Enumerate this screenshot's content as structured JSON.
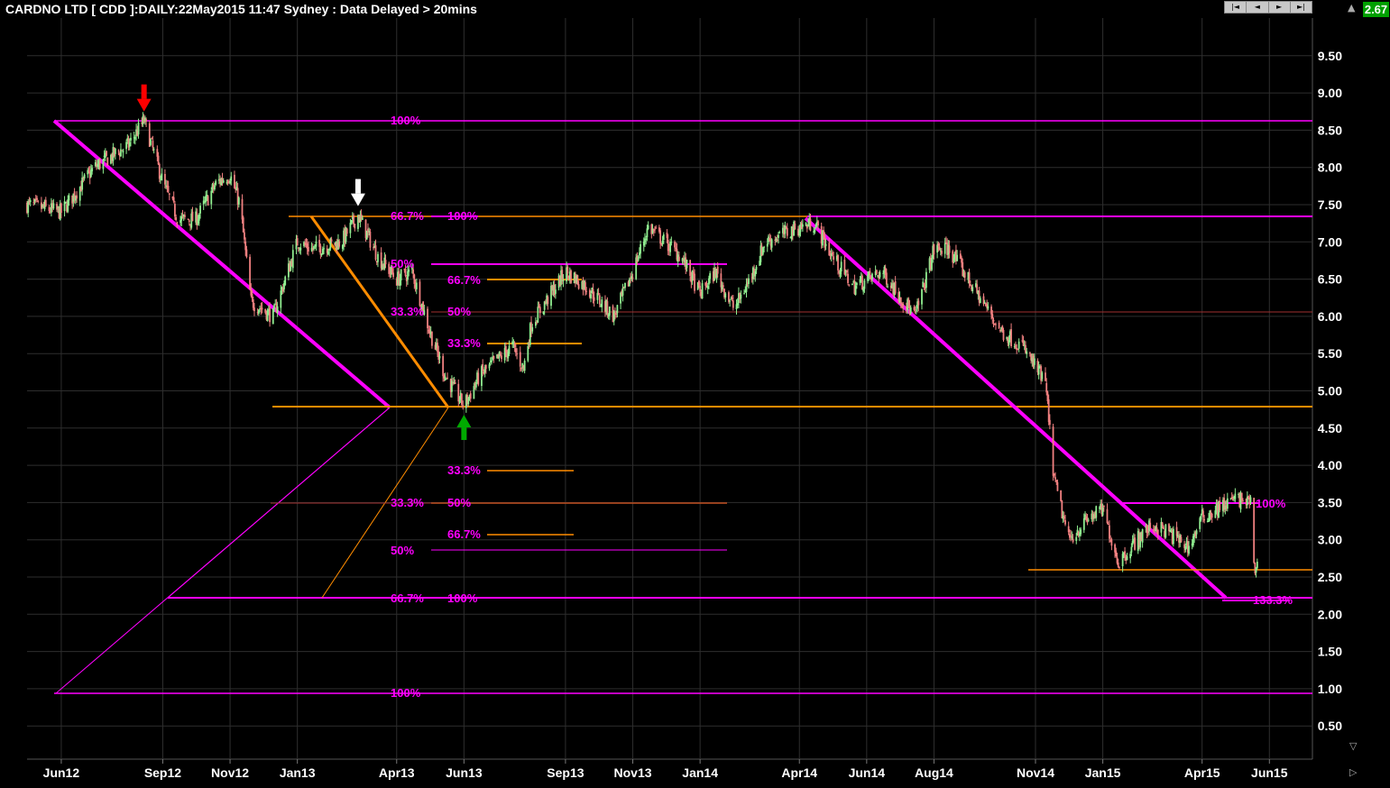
{
  "header": {
    "title": "CARDNO LTD [ CDD ]:DAILY:22May2015 11:47 Sydney : Data Delayed > 20mins",
    "nav_buttons": [
      "|◄",
      "◄",
      "►",
      "►|"
    ],
    "last_price": "2.67",
    "scroll_up_icon": "▲",
    "scroll_down_icon": "▽",
    "scroll_right_icon": "▷"
  },
  "colors": {
    "background": "#000000",
    "grid": "#2e2e2e",
    "up_candle": "#90ee90",
    "down_candle": "#f08080",
    "fib_magenta": "#ff00ff",
    "fib_orange": "#ff8c00",
    "price_label": "#ffffff",
    "last_price_bg": "#00a000"
  },
  "chart_data": {
    "type": "candlestick",
    "y_ticks": [
      "9.50",
      "9.00",
      "8.50",
      "8.00",
      "7.50",
      "7.00",
      "6.50",
      "6.00",
      "5.50",
      "5.00",
      "4.50",
      "4.00",
      "3.50",
      "3.00",
      "2.50",
      "2.00",
      "1.50",
      "1.00",
      "0.50"
    ],
    "ylim": [
      0.2,
      9.9
    ],
    "x_ticks": [
      "Jun12",
      "Sep12",
      "Nov12",
      "Jan13",
      "Apr13",
      "Jun13",
      "Sep13",
      "Nov13",
      "Jan14",
      "Apr14",
      "Jun14",
      "Aug14",
      "Nov14",
      "Jan15",
      "Apr15",
      "Jun15"
    ],
    "x_tick_dates": [
      "2012-06",
      "2012-09",
      "2012-11",
      "2013-01",
      "2013-04",
      "2013-06",
      "2013-09",
      "2013-11",
      "2014-01",
      "2014-04",
      "2014-06",
      "2014-08",
      "2014-11",
      "2015-01",
      "2015-04",
      "2015-06"
    ],
    "price_path": [
      [
        "2012-05-01",
        7.5
      ],
      [
        "2012-06-01",
        7.4
      ],
      [
        "2012-07-01",
        8.0
      ],
      [
        "2012-08-01",
        8.3
      ],
      [
        "2012-08-15",
        8.63
      ],
      [
        "2012-09-01",
        7.8
      ],
      [
        "2012-09-15",
        7.3
      ],
      [
        "2012-10-01",
        7.3
      ],
      [
        "2012-10-20",
        7.8
      ],
      [
        "2012-11-01",
        7.9
      ],
      [
        "2012-11-10",
        7.5
      ],
      [
        "2012-11-20",
        6.2
      ],
      [
        "2012-12-10",
        6.0
      ],
      [
        "2013-01-01",
        7.0
      ],
      [
        "2013-01-15",
        6.9
      ],
      [
        "2013-02-10",
        7.0
      ],
      [
        "2013-02-25",
        7.36
      ],
      [
        "2013-03-15",
        6.8
      ],
      [
        "2013-04-01",
        6.5
      ],
      [
        "2013-04-15",
        6.6
      ],
      [
        "2013-05-01",
        5.8
      ],
      [
        "2013-05-15",
        5.2
      ],
      [
        "2013-06-01",
        4.8
      ],
      [
        "2013-06-15",
        5.2
      ],
      [
        "2013-07-15",
        5.6
      ],
      [
        "2013-07-25",
        5.3
      ],
      [
        "2013-08-01",
        5.9
      ],
      [
        "2013-09-01",
        6.6
      ],
      [
        "2013-09-20",
        6.4
      ],
      [
        "2013-10-15",
        6.0
      ],
      [
        "2013-11-01",
        6.6
      ],
      [
        "2013-11-15",
        7.2
      ],
      [
        "2013-12-15",
        6.8
      ],
      [
        "2014-01-01",
        6.3
      ],
      [
        "2014-01-15",
        6.6
      ],
      [
        "2014-02-01",
        6.1
      ],
      [
        "2014-02-15",
        6.5
      ],
      [
        "2014-03-01",
        7.0
      ],
      [
        "2014-04-01",
        7.2
      ],
      [
        "2014-04-15",
        7.25
      ],
      [
        "2014-05-01",
        6.8
      ],
      [
        "2014-05-20",
        6.4
      ],
      [
        "2014-06-15",
        6.6
      ],
      [
        "2014-07-15",
        6.0
      ],
      [
        "2014-08-01",
        6.9
      ],
      [
        "2014-08-15",
        6.9
      ],
      [
        "2014-09-01",
        6.5
      ],
      [
        "2014-10-01",
        5.8
      ],
      [
        "2014-10-20",
        5.6
      ],
      [
        "2014-11-10",
        5.1
      ],
      [
        "2014-11-18",
        3.8
      ],
      [
        "2014-12-01",
        3.0
      ],
      [
        "2014-12-20",
        3.3
      ],
      [
        "2015-01-01",
        3.4
      ],
      [
        "2015-01-15",
        2.7
      ],
      [
        "2015-02-01",
        3.0
      ],
      [
        "2015-02-15",
        3.2
      ],
      [
        "2015-03-01",
        3.1
      ],
      [
        "2015-03-20",
        2.9
      ],
      [
        "2015-04-01",
        3.3
      ],
      [
        "2015-05-01",
        3.55
      ],
      [
        "2015-05-15",
        3.5
      ],
      [
        "2015-05-18",
        2.6
      ],
      [
        "2015-05-22",
        2.67
      ]
    ],
    "markers": [
      {
        "date": "2012-08-15",
        "price": 8.63,
        "color": "#ff0000",
        "direction": "down"
      },
      {
        "date": "2013-02-25",
        "price": 7.36,
        "color": "#ffffff",
        "direction": "down"
      },
      {
        "date": "2013-06-01",
        "price": 4.8,
        "color": "#00aa00",
        "direction": "up"
      }
    ],
    "fib_labels": [
      {
        "text": "100%",
        "color": "#ff00ff"
      },
      {
        "text": "66.7%",
        "color": "#ff00ff"
      },
      {
        "text": "100%",
        "color": "#ff00ff"
      },
      {
        "text": "50%",
        "color": "#ff00ff"
      },
      {
        "text": "66.7%",
        "color": "#ff00ff"
      },
      {
        "text": "33.3%",
        "color": "#ff00ff"
      },
      {
        "text": "50%",
        "color": "#ff00ff"
      },
      {
        "text": "33.3%",
        "color": "#ff00ff"
      },
      {
        "text": "33.3%",
        "color": "#ff00ff"
      },
      {
        "text": "33.3%",
        "color": "#ff00ff"
      },
      {
        "text": "50%",
        "color": "#ff00ff"
      },
      {
        "text": "66.7%",
        "color": "#ff00ff"
      },
      {
        "text": "50%",
        "color": "#ff00ff"
      },
      {
        "text": "66.7%",
        "color": "#ff00ff"
      },
      {
        "text": "100%",
        "color": "#ff00ff"
      },
      {
        "text": "100%",
        "color": "#ff00ff"
      },
      {
        "text": "100%",
        "color": "#ff00ff"
      },
      {
        "text": "133.3%",
        "color": "#ff00ff"
      }
    ]
  }
}
